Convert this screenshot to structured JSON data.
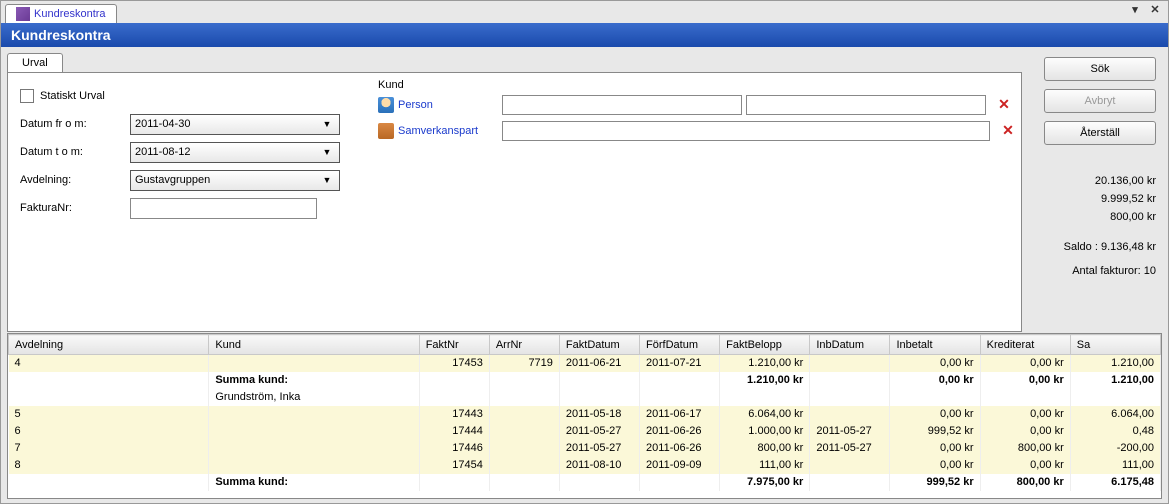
{
  "top_tab": "Kundreskontra",
  "title": "Kundreskontra",
  "main_tab": "Urval",
  "form": {
    "static_urval": "Statiskt Urval",
    "datum_from_label": "Datum fr o m:",
    "datum_from_value": "2011-04-30",
    "datum_to_label": "Datum t o m:",
    "datum_to_value": "2011-08-12",
    "avdelning_label": "Avdelning:",
    "avdelning_value": "Gustavgruppen",
    "fakturaNr_label": "FakturaNr:",
    "fakturaNr_value": ""
  },
  "kund": {
    "title": "Kund",
    "person_label": "Person",
    "samverkan_label": "Samverkanspart"
  },
  "buttons": {
    "sok": "Sök",
    "avbryt": "Avbryt",
    "aterstall": "Återställ"
  },
  "summary": {
    "v1": "20.136,00 kr",
    "v2": "9.999,52 kr",
    "v3": "800,00 kr",
    "saldo": "Saldo : 9.136,48 kr",
    "antal": "Antal fakturor: 10"
  },
  "cols": {
    "avdelning": "Avdelning",
    "kund": "Kund",
    "faktnr": "FaktNr",
    "arrnr": "ArrNr",
    "faktdatum": "FaktDatum",
    "forfdatum": "FörfDatum",
    "faktbelopp": "FaktBelopp",
    "inbdatum": "InbDatum",
    "inbetalt": "Inbetalt",
    "krediterat": "Krediterat",
    "saldo": "Sa"
  },
  "rows": {
    "r0": {
      "avd": "4",
      "kund": "",
      "faktnr": "17453",
      "arrnr": "7719",
      "fd": "2011-06-21",
      "ffd": "2011-07-21",
      "fb": "1.210,00 kr",
      "ibd": "",
      "inb": "0,00 kr",
      "kre": "0,00 kr",
      "sal": "1.210,00"
    },
    "r1": {
      "kund": "Summa kund:",
      "fb": "1.210,00 kr",
      "inb": "0,00 kr",
      "kre": "0,00 kr",
      "sal": "1.210,00"
    },
    "r2": {
      "kund": "Grundström, Inka"
    },
    "r3": {
      "avd": "5",
      "faktnr": "17443",
      "fd": "2011-05-18",
      "ffd": "2011-06-17",
      "fb": "6.064,00 kr",
      "inb": "0,00 kr",
      "kre": "0,00 kr",
      "sal": "6.064,00"
    },
    "r4": {
      "avd": "6",
      "faktnr": "17444",
      "fd": "2011-05-27",
      "ffd": "2011-06-26",
      "fb": "1.000,00 kr",
      "ibd": "2011-05-27",
      "inb": "999,52 kr",
      "kre": "0,00 kr",
      "sal": "0,48"
    },
    "r5": {
      "avd": "7",
      "faktnr": "17446",
      "fd": "2011-05-27",
      "ffd": "2011-06-26",
      "fb": "800,00 kr",
      "ibd": "2011-05-27",
      "inb": "0,00 kr",
      "kre": "800,00 kr",
      "sal": "-200,00"
    },
    "r6": {
      "avd": "8",
      "faktnr": "17454",
      "fd": "2011-08-10",
      "ffd": "2011-09-09",
      "fb": "111,00 kr",
      "inb": "0,00 kr",
      "kre": "0,00 kr",
      "sal": "111,00"
    },
    "r7": {
      "kund": "Summa kund:",
      "fb": "7.975,00 kr",
      "inb": "999,52 kr",
      "kre": "800,00 kr",
      "sal": "6.175,48"
    }
  }
}
